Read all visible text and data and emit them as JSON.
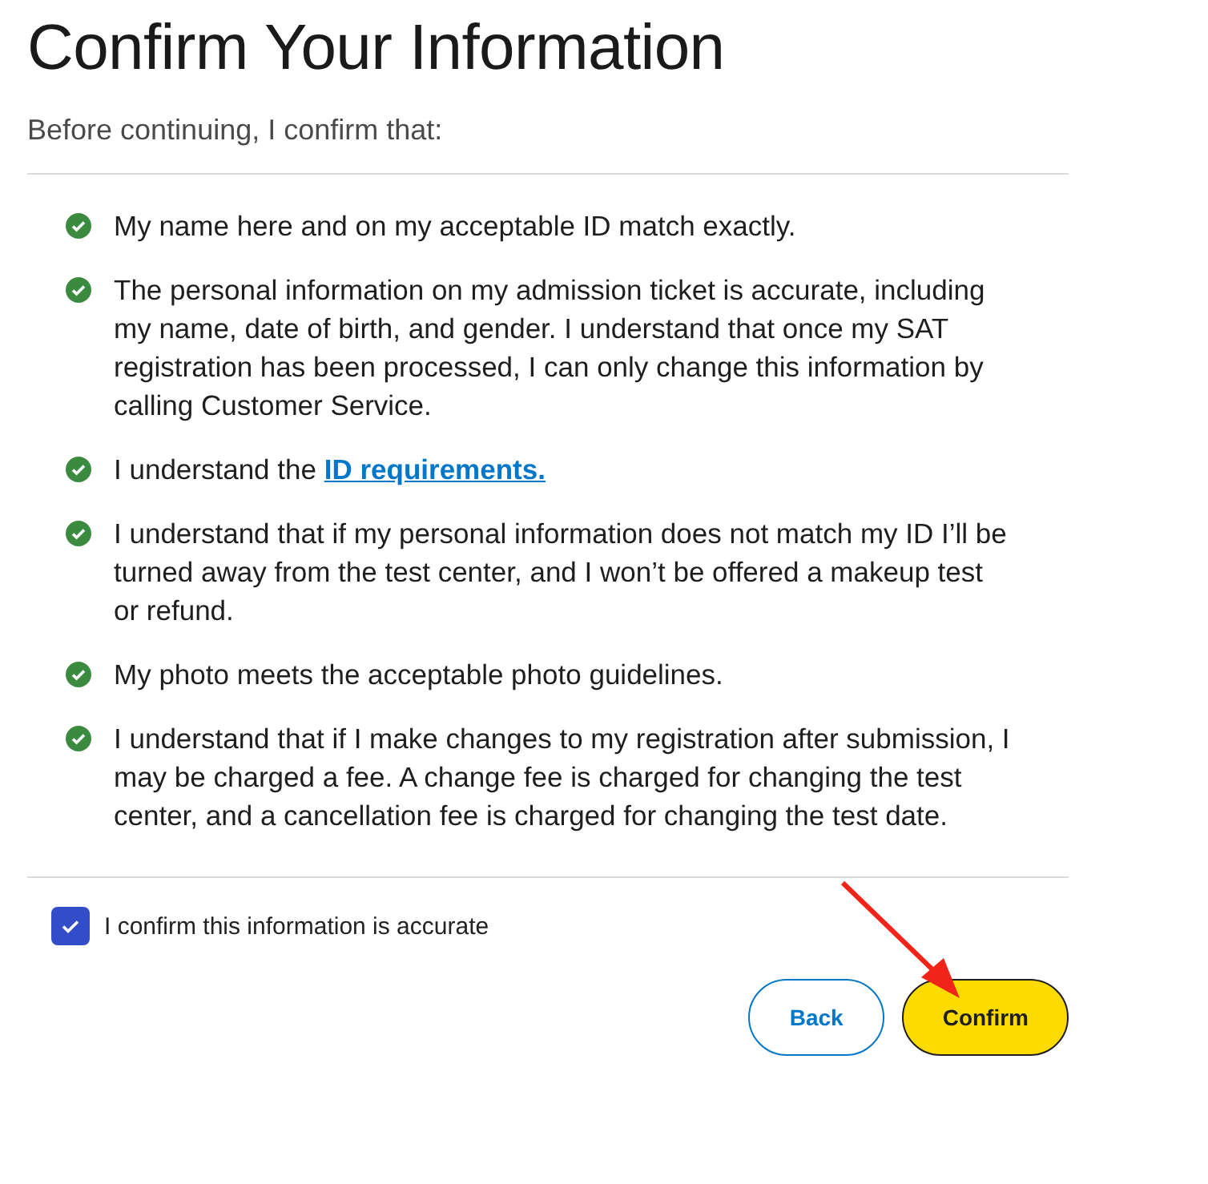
{
  "title": "Confirm Your Information",
  "intro": "Before continuing, I confirm that:",
  "statements": [
    {
      "text": "My name here and on my acceptable ID match exactly."
    },
    {
      "text": "The personal information on my admission ticket is accurate, including my name, date of birth, and gender. I understand that once my SAT registration has been processed, I can only change this information by calling Customer Service."
    },
    {
      "text": "I understand the ",
      "link": "ID requirements."
    },
    {
      "text": "I understand that if my personal information does not match my ID I’ll be turned away from the test center, and I won’t be offered a makeup test or refund."
    },
    {
      "text": "My photo meets the acceptable photo guidelines."
    },
    {
      "text": "I understand that if I make changes to my registration after submission, I may be charged a fee. A change fee is charged for changing the test center, and a cancellation fee is charged for changing the test date."
    }
  ],
  "confirmation": {
    "label": "I confirm this information is accurate",
    "checked": true
  },
  "buttons": [
    {
      "label": "Back",
      "kind": "secondary"
    },
    {
      "label": "Confirm",
      "kind": "primary"
    }
  ]
}
